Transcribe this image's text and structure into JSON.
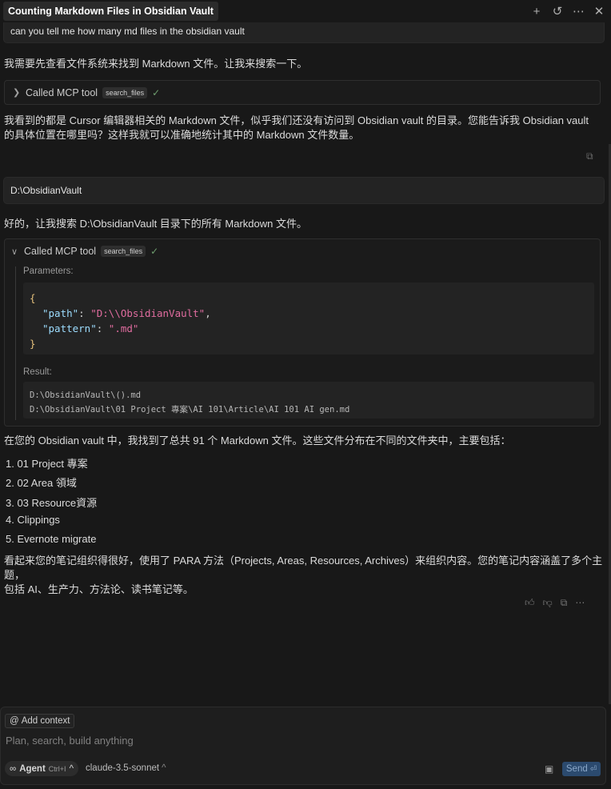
{
  "header": {
    "title": "Counting Markdown Files in Obsidian Vault",
    "icons": [
      "plus-icon",
      "history-icon",
      "more-icon",
      "close-icon"
    ]
  },
  "messages": {
    "user1": "can you tell me how many md files in the obsidian vault",
    "assistant1": "我需要先查看文件系统来找到 Markdown 文件。让我来搜索一下。",
    "tool1": {
      "label": "Called MCP tool",
      "tag": "search_files"
    },
    "assistant2_line1": "我看到的都是 Cursor 编辑器相关的 Markdown 文件，似乎我们还没有访问到 Obsidian vault 的目录。您能告诉我 Obsidian vault",
    "assistant2_line2": "的具体位置在哪里吗？这样我就可以准确地统计其中的 Markdown 文件数量。",
    "user2": "D:\\ObsidianVault",
    "assistant3": "好的，让我搜索 D:\\ObsidianVault 目录下的所有 Markdown 文件。",
    "tool2": {
      "label": "Called MCP tool",
      "tag": "search_files",
      "params_label": "Parameters:",
      "params": {
        "open": "{",
        "path_key": "\"path\"",
        "path_value": "\"D:\\\\ObsidianVault\"",
        "pattern_key": "\"pattern\"",
        "pattern_value": "\".md\"",
        "close": "}"
      },
      "result_label": "Result:",
      "result_lines": [
        "D:\\ObsidianVault\\().md",
        "D:\\ObsidianVault\\01 Project 專案\\AI 101\\Article\\AI 101 AI gen.md"
      ]
    },
    "assistant4_intro": "在您的 Obsidian vault 中，我找到了总共 91 个 Markdown 文件。这些文件分布在不同的文件夹中，主要包括：",
    "folders": [
      "1. 01 Project 專案",
      "2. 02 Area 領域",
      "3. 03 Resource資源",
      "4. Clippings",
      "5. Evernote migrate"
    ],
    "assistant4_outro_line1": "看起来您的笔记组织得很好，使用了 PARA 方法（Projects, Areas, Resources, Archives）来组织内容。您的笔记内容涵盖了多个主题，",
    "assistant4_outro_line2": "包括 AI、生产力、方法论、读书笔记等。"
  },
  "composer": {
    "add_context": "Add context",
    "placeholder": "Plan, search, build anything",
    "agent_label": "Agent",
    "agent_shortcut": "Ctrl+I",
    "model": "claude-3.5-sonnet",
    "send_label": "Send"
  },
  "colors": {
    "background": "#181818",
    "string_pink": "#e06c9f",
    "key_blue": "#9cdcfe",
    "brace_yellow": "#e5c07b",
    "send_blue": "#2b4a6e"
  }
}
